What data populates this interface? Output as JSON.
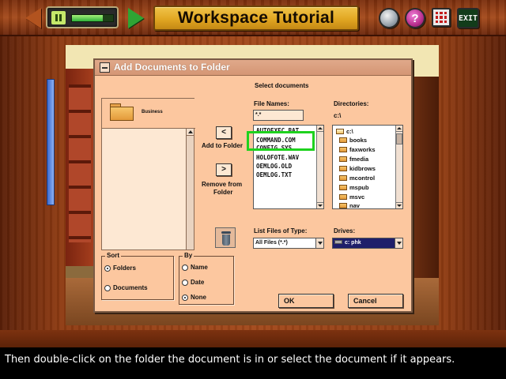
{
  "app": {
    "title": "Workspace Tutorial",
    "exit_label": "EXIT",
    "help_label": "?",
    "progress_fraction": 0.75
  },
  "dialog": {
    "title": "Add Documents to Folder",
    "select_documents_label": "Select documents",
    "folder_name": "Business",
    "file_names_label": "File Names:",
    "file_name_value": "*.*",
    "files": [
      "AUTOEXEC.BAT",
      "COMMAND.COM",
      "CONFIG.SYS",
      "HOLOFOTE.WAV",
      "OEMLOG.OLD",
      "OEMLOG.TXT"
    ],
    "directories_label": "Directories:",
    "current_dir": "c:\\",
    "root_dir": "c:\\",
    "directories": [
      "books",
      "faxworks",
      "fmedia",
      "kidbrows",
      "mcontrol",
      "mspub",
      "msvc",
      "nav"
    ],
    "add_button": "<",
    "add_label": "Add to Folder",
    "remove_button": ">",
    "remove_label_1": "Remove from",
    "remove_label_2": "Folder",
    "list_type_label": "List Files of Type:",
    "list_type_value": "All Files (*.*)",
    "drives_label": "Drives:",
    "drive_value": "c: phk",
    "sort_group": "Sort",
    "sort_options": [
      "Folders",
      "Documents"
    ],
    "by_group": "By",
    "by_options": [
      "Name",
      "Date",
      "None"
    ],
    "ok_label": "OK",
    "cancel_label": "Cancel"
  },
  "caption": "Then double-click on the folder the document is in or select the document if it appears.",
  "icons": {
    "back": "left-arrow-icon",
    "forward": "right-arrow-icon",
    "pause": "pause-icon",
    "globe": "globe-icon",
    "help": "help-icon",
    "grid": "grid-icon",
    "exit": "exit-icon",
    "trash": "trash-icon",
    "folder": "folder-icon"
  },
  "colors": {
    "dialog_bg": "#fcc79f",
    "highlight": "#1ed21e",
    "title_plate": "#e1a622"
  }
}
